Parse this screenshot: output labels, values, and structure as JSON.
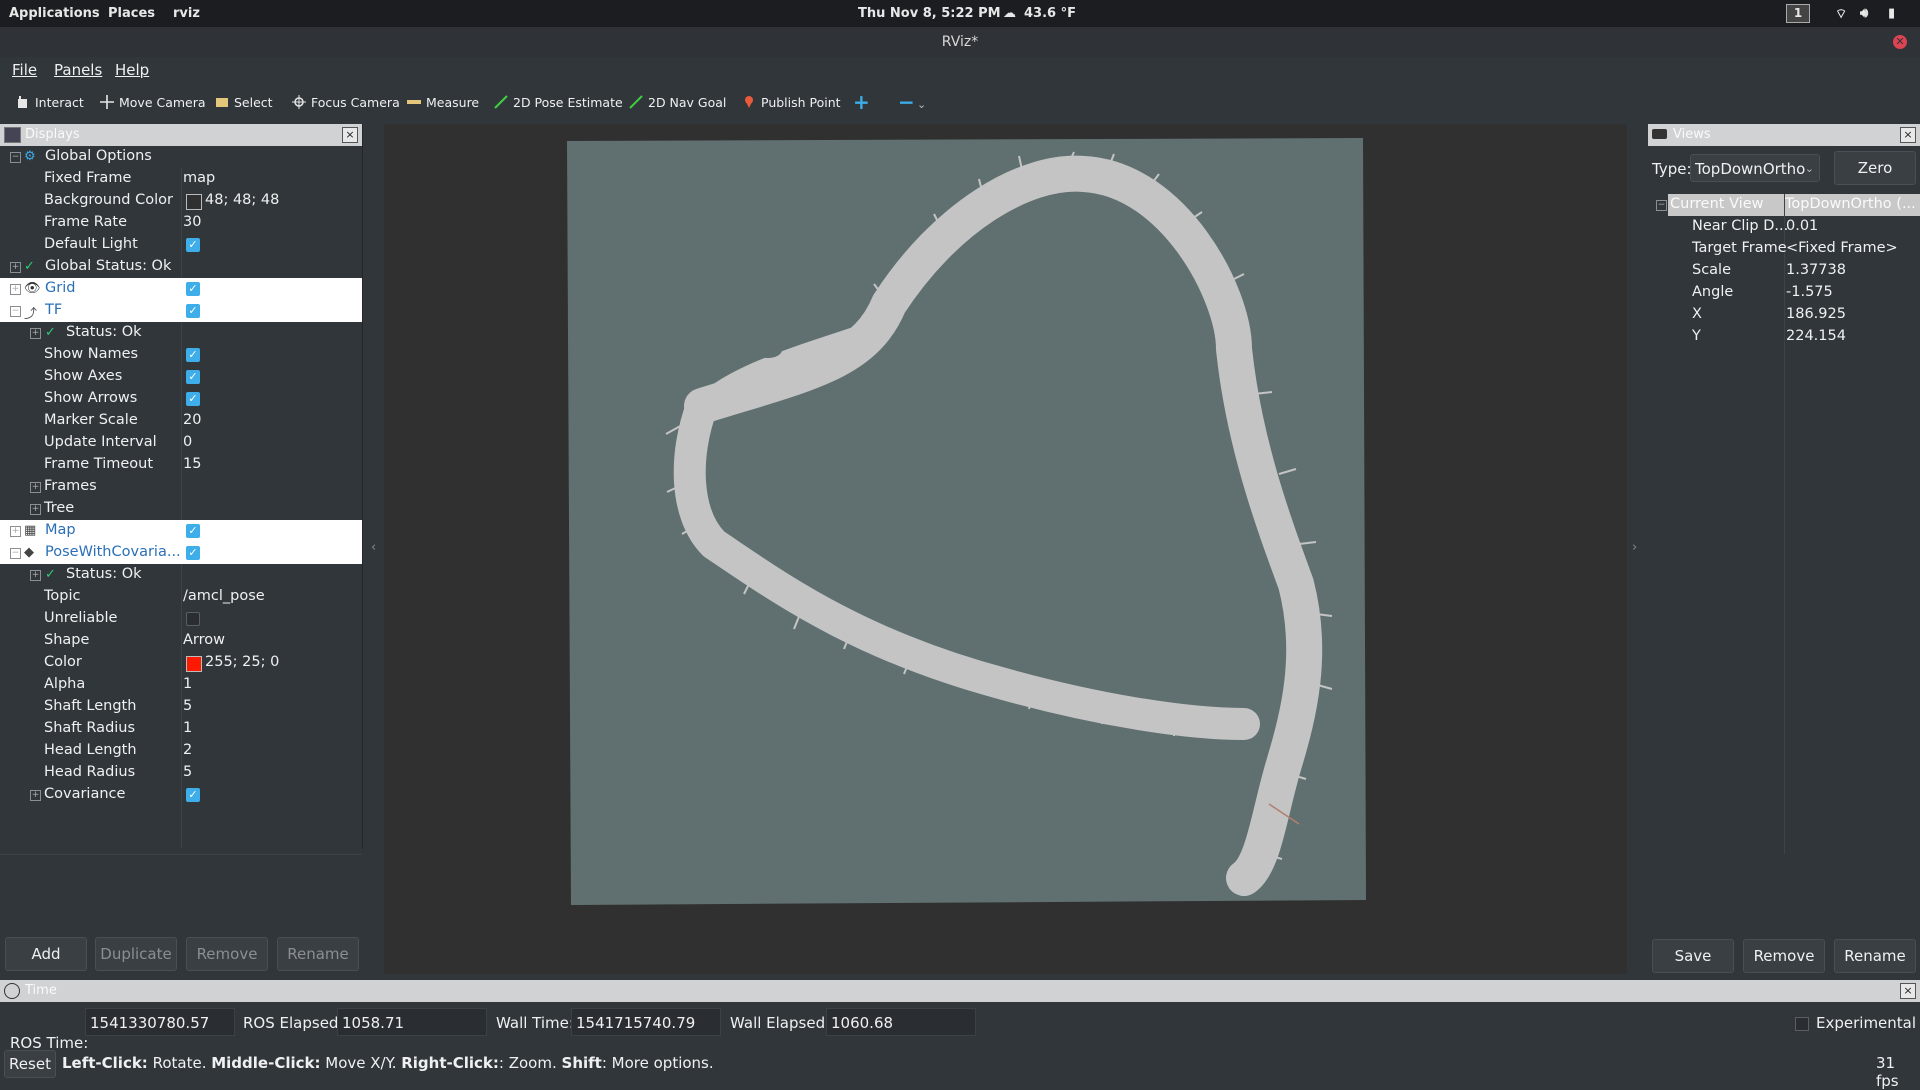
{
  "system_bar": {
    "applications": "Applications",
    "places": "Places",
    "app": "rviz",
    "clock": "Thu Nov  8,  5:22 PM",
    "weather": "43.6 °F",
    "workspace": "1"
  },
  "window": {
    "title": "RViz*"
  },
  "menu": {
    "file": "File",
    "panels": "Panels",
    "help": "Help"
  },
  "toolbar": {
    "interact": "Interact",
    "move_camera": "Move Camera",
    "select": "Select",
    "focus_camera": "Focus Camera",
    "measure": "Measure",
    "pose_estimate": "2D Pose Estimate",
    "nav_goal": "2D Nav Goal",
    "publish_point": "Publish Point",
    "add": "+",
    "remove": "−"
  },
  "displays": {
    "title": "Displays",
    "rows": [
      {
        "name": "Global Options",
        "value": ""
      },
      {
        "name": "Fixed Frame",
        "value": "map"
      },
      {
        "name": "Background Color",
        "value": "48; 48; 48"
      },
      {
        "name": "Frame Rate",
        "value": "30"
      },
      {
        "name": "Default Light",
        "value": ""
      },
      {
        "name": "Global Status: Ok",
        "value": ""
      },
      {
        "name": "Grid",
        "value": ""
      },
      {
        "name": "TF",
        "value": ""
      },
      {
        "name": "Status: Ok",
        "value": ""
      },
      {
        "name": "Show Names",
        "value": ""
      },
      {
        "name": "Show Axes",
        "value": ""
      },
      {
        "name": "Show Arrows",
        "value": ""
      },
      {
        "name": "Marker Scale",
        "value": "20"
      },
      {
        "name": "Update Interval",
        "value": "0"
      },
      {
        "name": "Frame Timeout",
        "value": "15"
      },
      {
        "name": "Frames",
        "value": ""
      },
      {
        "name": "Tree",
        "value": ""
      },
      {
        "name": "Map",
        "value": ""
      },
      {
        "name": "PoseWithCovaria...",
        "value": ""
      },
      {
        "name": "Status: Ok",
        "value": ""
      },
      {
        "name": "Topic",
        "value": "/amcl_pose"
      },
      {
        "name": "Unreliable",
        "value": ""
      },
      {
        "name": "Shape",
        "value": "Arrow"
      },
      {
        "name": "Color",
        "value": "255; 25; 0"
      },
      {
        "name": "Alpha",
        "value": "1"
      },
      {
        "name": "Shaft Length",
        "value": "5"
      },
      {
        "name": "Shaft Radius",
        "value": "1"
      },
      {
        "name": "Head Length",
        "value": "2"
      },
      {
        "name": "Head Radius",
        "value": "5"
      },
      {
        "name": "Covariance",
        "value": ""
      }
    ],
    "buttons": {
      "add": "Add",
      "duplicate": "Duplicate",
      "remove": "Remove",
      "rename": "Rename"
    },
    "colors": {
      "background": "#303030",
      "pose": "#ff1900"
    }
  },
  "views": {
    "title": "Views",
    "type_label": "Type:",
    "type_value": "TopDownOrtho",
    "zero": "Zero",
    "header_name": "Current View",
    "header_value": "TopDownOrtho (...",
    "rows": [
      {
        "name": "Near Clip D...",
        "value": "0.01"
      },
      {
        "name": "Target Frame",
        "value": "<Fixed Frame>"
      },
      {
        "name": "Scale",
        "value": "1.37738"
      },
      {
        "name": "Angle",
        "value": "-1.575"
      },
      {
        "name": "X",
        "value": "186.925"
      },
      {
        "name": "Y",
        "value": "224.154"
      }
    ],
    "buttons": {
      "save": "Save",
      "remove": "Remove",
      "rename": "Rename"
    }
  },
  "time": {
    "title": "Time",
    "ros_time_label": "ROS Time:",
    "ros_time": "1541330780.57",
    "ros_elapsed_label": "ROS Elapsed:",
    "ros_elapsed": "1058.71",
    "wall_time_label": "Wall Time:",
    "wall_time": "1541715740.79",
    "wall_elapsed_label": "Wall Elapsed:",
    "wall_elapsed": "1060.68",
    "experimental": "Experimental"
  },
  "status": {
    "reset": "Reset",
    "left": "Left-Click:",
    "left_t": " Rotate. ",
    "middle": "Middle-Click:",
    "middle_t": " Move X/Y. ",
    "right": "Right-Click:",
    "right_t": ": Zoom. ",
    "shift": "Shift",
    "shift_t": ": More options.",
    "fps": "31 fps"
  }
}
